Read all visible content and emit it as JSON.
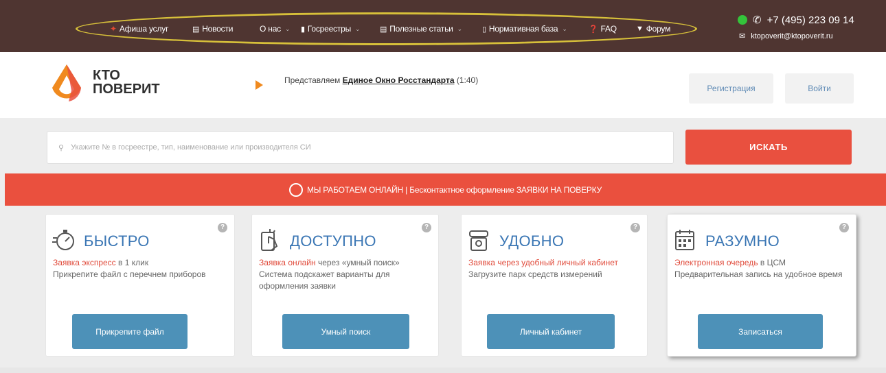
{
  "topbar": {
    "nav": [
      {
        "label": "Афиша услуг",
        "icon": "star-icon"
      },
      {
        "label": "Новости",
        "icon": "newspaper-icon"
      },
      {
        "label": "О нас",
        "icon": "",
        "dropdown": true
      },
      {
        "label": "Госреестры",
        "icon": "book-icon",
        "dropdown": true
      },
      {
        "label": "Полезные статьи",
        "icon": "newspaper-icon",
        "dropdown": true
      },
      {
        "label": "Нормативная база",
        "icon": "document-icon",
        "dropdown": true
      },
      {
        "label": "FAQ",
        "icon": "question-icon"
      },
      {
        "label": "Форум",
        "icon": "chat-icon"
      }
    ],
    "phone": "+7 (495) 223 09 14",
    "email": "ktopoverit@ktopoverit.ru"
  },
  "header": {
    "logo_line1": "КТО",
    "logo_line2": "ПОВЕРИТ",
    "promo_prefix": "Представляем",
    "promo_link": "Единое Окно Росстандарта",
    "promo_suffix": "(1:40)",
    "register_label": "Регистрация",
    "login_label": "Войти"
  },
  "search": {
    "placeholder": "Укажите № в госреестре, тип, наименование или производителя СИ",
    "button_label": "ИСКАТЬ"
  },
  "banner": {
    "text": "МЫ РАБОТАЕМ ОНЛАЙН | Бесконтактное оформление ЗАЯВКИ НА ПОВЕРКУ"
  },
  "cards": [
    {
      "title": "БЫСТРО",
      "icon": "stopwatch-icon",
      "highlight": "Заявка экспресс",
      "text_after": " в 1 клик",
      "text": "Прикрепите файл с перечнем приборов",
      "button": "Прикрепите файл"
    },
    {
      "title": "ДОСТУПНО",
      "icon": "touch-icon",
      "highlight": "Заявка онлайн",
      "text_after": " через «умный поиск»",
      "text": "Система подскажет варианты для оформления заявки",
      "button": "Умный поиск"
    },
    {
      "title": "УДОБНО",
      "icon": "user-cabinet-icon",
      "highlight": "Заявка через удобный личный кабинет",
      "text_after": "",
      "text": "Загрузите парк средств измерений",
      "button": "Личный кабинет"
    },
    {
      "title": "РАЗУМНО",
      "icon": "calendar-icon",
      "highlight": "Электронная очередь",
      "text_after": " в ЦСМ",
      "text": "Предварительная запись на удобное время",
      "button": "Записаться"
    }
  ],
  "colors": {
    "topbar": "#4f3531",
    "accent_red": "#e9503f",
    "button_blue": "#4d91b8",
    "title_blue": "#3a76b4",
    "highlight_ellipse": "#d7c03a"
  }
}
